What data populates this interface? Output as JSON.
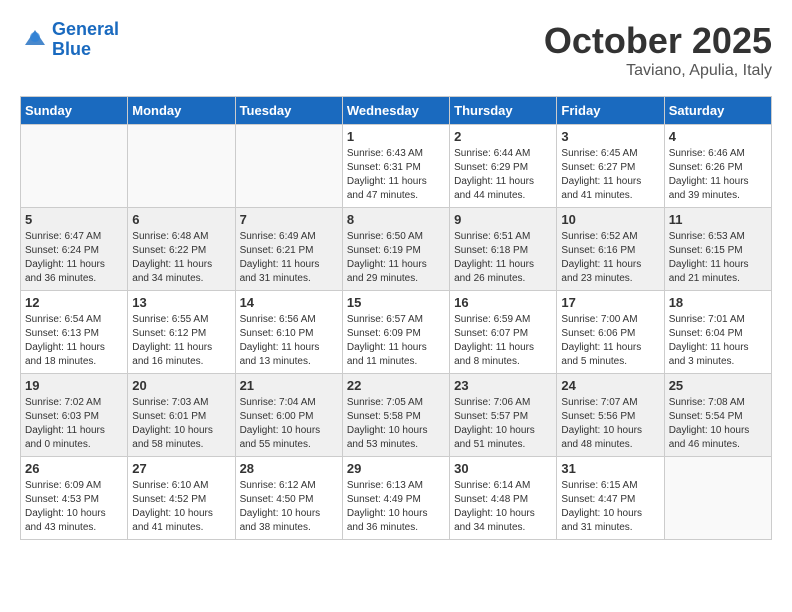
{
  "header": {
    "logo_line1": "General",
    "logo_line2": "Blue",
    "month": "October 2025",
    "location": "Taviano, Apulia, Italy"
  },
  "weekdays": [
    "Sunday",
    "Monday",
    "Tuesday",
    "Wednesday",
    "Thursday",
    "Friday",
    "Saturday"
  ],
  "weeks": [
    [
      {
        "day": "",
        "info": ""
      },
      {
        "day": "",
        "info": ""
      },
      {
        "day": "",
        "info": ""
      },
      {
        "day": "1",
        "info": "Sunrise: 6:43 AM\nSunset: 6:31 PM\nDaylight: 11 hours\nand 47 minutes."
      },
      {
        "day": "2",
        "info": "Sunrise: 6:44 AM\nSunset: 6:29 PM\nDaylight: 11 hours\nand 44 minutes."
      },
      {
        "day": "3",
        "info": "Sunrise: 6:45 AM\nSunset: 6:27 PM\nDaylight: 11 hours\nand 41 minutes."
      },
      {
        "day": "4",
        "info": "Sunrise: 6:46 AM\nSunset: 6:26 PM\nDaylight: 11 hours\nand 39 minutes."
      }
    ],
    [
      {
        "day": "5",
        "info": "Sunrise: 6:47 AM\nSunset: 6:24 PM\nDaylight: 11 hours\nand 36 minutes."
      },
      {
        "day": "6",
        "info": "Sunrise: 6:48 AM\nSunset: 6:22 PM\nDaylight: 11 hours\nand 34 minutes."
      },
      {
        "day": "7",
        "info": "Sunrise: 6:49 AM\nSunset: 6:21 PM\nDaylight: 11 hours\nand 31 minutes."
      },
      {
        "day": "8",
        "info": "Sunrise: 6:50 AM\nSunset: 6:19 PM\nDaylight: 11 hours\nand 29 minutes."
      },
      {
        "day": "9",
        "info": "Sunrise: 6:51 AM\nSunset: 6:18 PM\nDaylight: 11 hours\nand 26 minutes."
      },
      {
        "day": "10",
        "info": "Sunrise: 6:52 AM\nSunset: 6:16 PM\nDaylight: 11 hours\nand 23 minutes."
      },
      {
        "day": "11",
        "info": "Sunrise: 6:53 AM\nSunset: 6:15 PM\nDaylight: 11 hours\nand 21 minutes."
      }
    ],
    [
      {
        "day": "12",
        "info": "Sunrise: 6:54 AM\nSunset: 6:13 PM\nDaylight: 11 hours\nand 18 minutes."
      },
      {
        "day": "13",
        "info": "Sunrise: 6:55 AM\nSunset: 6:12 PM\nDaylight: 11 hours\nand 16 minutes."
      },
      {
        "day": "14",
        "info": "Sunrise: 6:56 AM\nSunset: 6:10 PM\nDaylight: 11 hours\nand 13 minutes."
      },
      {
        "day": "15",
        "info": "Sunrise: 6:57 AM\nSunset: 6:09 PM\nDaylight: 11 hours\nand 11 minutes."
      },
      {
        "day": "16",
        "info": "Sunrise: 6:59 AM\nSunset: 6:07 PM\nDaylight: 11 hours\nand 8 minutes."
      },
      {
        "day": "17",
        "info": "Sunrise: 7:00 AM\nSunset: 6:06 PM\nDaylight: 11 hours\nand 5 minutes."
      },
      {
        "day": "18",
        "info": "Sunrise: 7:01 AM\nSunset: 6:04 PM\nDaylight: 11 hours\nand 3 minutes."
      }
    ],
    [
      {
        "day": "19",
        "info": "Sunrise: 7:02 AM\nSunset: 6:03 PM\nDaylight: 11 hours\nand 0 minutes."
      },
      {
        "day": "20",
        "info": "Sunrise: 7:03 AM\nSunset: 6:01 PM\nDaylight: 10 hours\nand 58 minutes."
      },
      {
        "day": "21",
        "info": "Sunrise: 7:04 AM\nSunset: 6:00 PM\nDaylight: 10 hours\nand 55 minutes."
      },
      {
        "day": "22",
        "info": "Sunrise: 7:05 AM\nSunset: 5:58 PM\nDaylight: 10 hours\nand 53 minutes."
      },
      {
        "day": "23",
        "info": "Sunrise: 7:06 AM\nSunset: 5:57 PM\nDaylight: 10 hours\nand 51 minutes."
      },
      {
        "day": "24",
        "info": "Sunrise: 7:07 AM\nSunset: 5:56 PM\nDaylight: 10 hours\nand 48 minutes."
      },
      {
        "day": "25",
        "info": "Sunrise: 7:08 AM\nSunset: 5:54 PM\nDaylight: 10 hours\nand 46 minutes."
      }
    ],
    [
      {
        "day": "26",
        "info": "Sunrise: 6:09 AM\nSunset: 4:53 PM\nDaylight: 10 hours\nand 43 minutes."
      },
      {
        "day": "27",
        "info": "Sunrise: 6:10 AM\nSunset: 4:52 PM\nDaylight: 10 hours\nand 41 minutes."
      },
      {
        "day": "28",
        "info": "Sunrise: 6:12 AM\nSunset: 4:50 PM\nDaylight: 10 hours\nand 38 minutes."
      },
      {
        "day": "29",
        "info": "Sunrise: 6:13 AM\nSunset: 4:49 PM\nDaylight: 10 hours\nand 36 minutes."
      },
      {
        "day": "30",
        "info": "Sunrise: 6:14 AM\nSunset: 4:48 PM\nDaylight: 10 hours\nand 34 minutes."
      },
      {
        "day": "31",
        "info": "Sunrise: 6:15 AM\nSunset: 4:47 PM\nDaylight: 10 hours\nand 31 minutes."
      },
      {
        "day": "",
        "info": ""
      }
    ]
  ]
}
